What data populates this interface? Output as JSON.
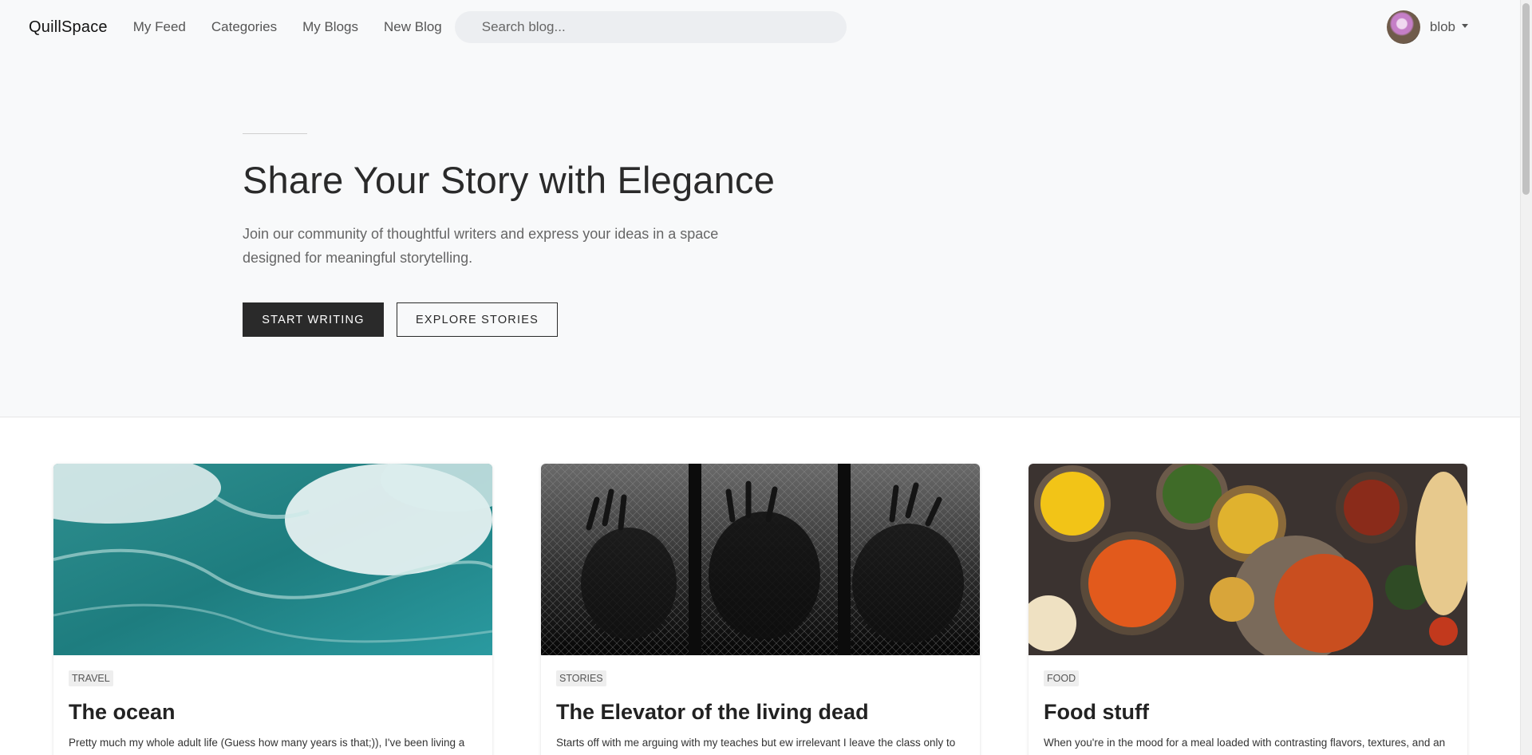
{
  "navbar": {
    "brand": "QuillSpace",
    "links": [
      "My Feed",
      "Categories",
      "My Blogs",
      "New Blog"
    ],
    "search_placeholder": "Search blog...",
    "user_name": "blob"
  },
  "hero": {
    "title": "Share Your Story with Elegance",
    "subtitle_line1": "Join our community of thoughtful writers and express your ideas in a space",
    "subtitle_line2": "designed for meaningful storytelling.",
    "primary_button": "START WRITING",
    "secondary_button": "EXPLORE STORIES"
  },
  "cards": [
    {
      "tag": "TRAVEL",
      "title": "The ocean",
      "excerpt": "Pretty much my whole adult life (Guess how many years is that;)), I've been living a",
      "image": "ocean-waves"
    },
    {
      "tag": "STORIES",
      "title": "The Elevator of the living dead",
      "excerpt": "Starts off with me arguing with my teaches but ew irrelevant I leave the class only to",
      "image": "zombie-hands-fence"
    },
    {
      "tag": "FOOD",
      "title": "Food stuff",
      "excerpt": "When you're in the mood for a meal loaded with contrasting flavors, textures, and an",
      "image": "indian-food-spread"
    }
  ],
  "colors": {
    "hero_bg": "#f8f9fa",
    "primary_button": "#2a2a2a",
    "search_bg": "#eceef1"
  }
}
